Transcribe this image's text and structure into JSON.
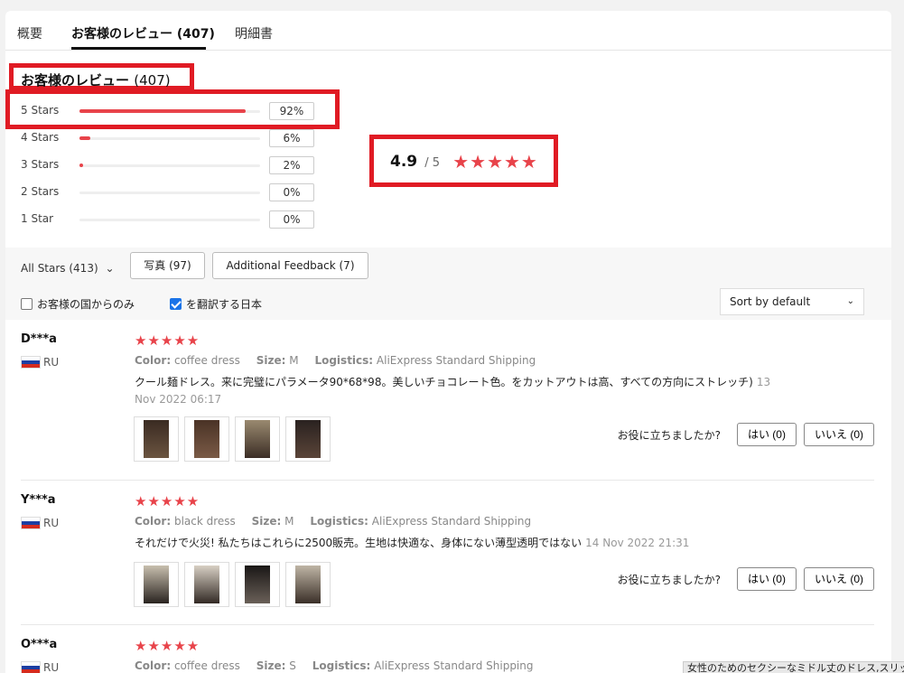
{
  "tabs": [
    {
      "label": "概要"
    },
    {
      "label": "お客様のレビュー (407)"
    },
    {
      "label": "明細書"
    }
  ],
  "summary": {
    "title": "お客様のレビュー",
    "count": "(407)",
    "breakdown": [
      {
        "label": "5 Stars",
        "pct": "92%",
        "fraction": 0.92
      },
      {
        "label": "4 Stars",
        "pct": "6%",
        "fraction": 0.06
      },
      {
        "label": "3 Stars",
        "pct": "2%",
        "fraction": 0.02
      },
      {
        "label": "2 Stars",
        "pct": "0%",
        "fraction": 0
      },
      {
        "label": "1 Star",
        "pct": "0%",
        "fraction": 0
      }
    ],
    "score": "4.9",
    "out_of": "/ 5",
    "stars": "★★★★★"
  },
  "filters": {
    "all_stars": "All Stars (413)",
    "chevron": "⌄",
    "photos_button": "写真 (97)",
    "additional_button": "Additional Feedback (7)",
    "own_country_label": "お客様の国からのみ",
    "own_country_checked": false,
    "translate_label": "を翻訳する日本",
    "translate_checked": true,
    "sort_label": "Sort by default"
  },
  "helpful": {
    "question": "お役に立ちましたか?",
    "yes": "はい (0)",
    "no": "いいえ (0)"
  },
  "attr_labels": {
    "color": "Color:",
    "size": "Size:",
    "logistics": "Logistics:"
  },
  "reviews": [
    {
      "name": "D***a",
      "country": "RU",
      "stars": "★★★★★",
      "color": "coffee dress",
      "size": "M",
      "logistics": "AliExpress Standard Shipping",
      "text": "クール麺ドレス。来に完璧にパラメータ90*68*98。美しいチョコレート色。をカットアウトは高、すべての方向にストレッチ)",
      "date": "13 Nov 2022 06:17"
    },
    {
      "name": "Y***a",
      "country": "RU",
      "stars": "★★★★★",
      "color": "black dress",
      "size": "M",
      "logistics": "AliExpress Standard Shipping",
      "text": "それだけで火災! 私たちはこれらに2500販売。生地は快適な、身体にない薄型透明ではない",
      "date": "14 Nov 2022 21:31"
    },
    {
      "name": "O***a",
      "country": "RU",
      "stars": "★★★★★",
      "color": "coffee dress",
      "size": "S",
      "logistics": "AliExpress Standard Shipping",
      "text": "",
      "date": ""
    }
  ],
  "tooltip": "女性のためのセクシーなミドル丈のドレス,スリッ",
  "colors": {
    "accent": "#e8434a",
    "highlight_box": "#e01b24",
    "checkbox": "#1a73e8"
  }
}
